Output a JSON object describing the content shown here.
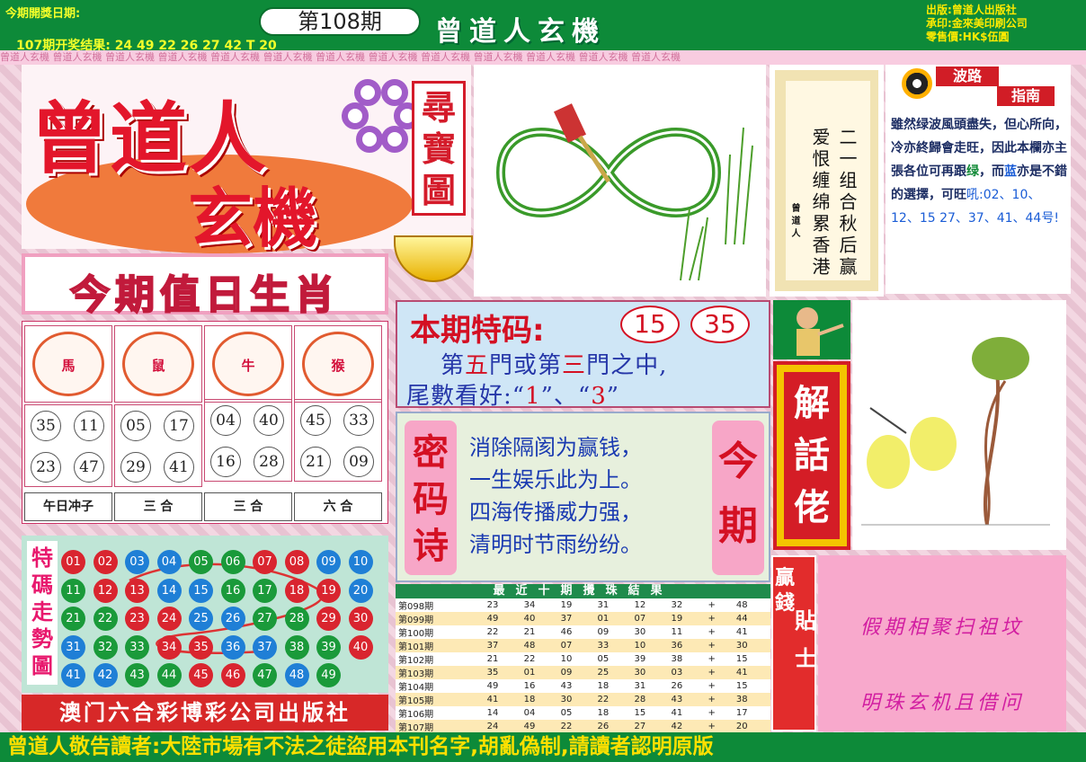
{
  "header": {
    "date_label": "今期開獎日期:",
    "prev_result": "107期开奖结果:  24 49 22 26 27 42 T 20",
    "issue": "第108期",
    "brand": "曾道人玄機",
    "publisher": [
      "出版:曾道人出版社",
      "承印:金來美印刷公司",
      "零售價:HK$伍圓"
    ]
  },
  "strip": "曾道人玄機 曾道人玄機 曾道人玄機 曾道人玄機 曾道人玄機 曾道人玄機 曾道人玄機 曾道人玄機 曾道人玄機 曾道人玄機 曾道人玄機 曾道人玄機 曾道人玄機",
  "logo": {
    "line1": "曾道人",
    "line2": "玄機",
    "side": "尋寶圖"
  },
  "zodiac": {
    "title": "今期值日生肖",
    "animals": [
      {
        "char": "馬"
      },
      {
        "char": "鼠"
      },
      {
        "char": "牛"
      },
      {
        "char": "猴"
      }
    ],
    "numbers": [
      [
        "35",
        "11",
        "23",
        "47"
      ],
      [
        "05",
        "17",
        "29",
        "41"
      ],
      [
        "04",
        "40",
        "16",
        "28"
      ],
      [
        "45",
        "33",
        "21",
        "09"
      ]
    ],
    "labels": [
      "午日冲子",
      "三  合",
      "三  合",
      "六  合"
    ]
  },
  "trend": {
    "label": "特碼走勢圖",
    "rows": [
      [
        [
          "01",
          "r"
        ],
        [
          "02",
          "r"
        ],
        [
          "03",
          "b"
        ],
        [
          "04",
          "b"
        ],
        [
          "05",
          "g"
        ],
        [
          "06",
          "g"
        ],
        [
          "07",
          "r"
        ],
        [
          "08",
          "r"
        ],
        [
          "09",
          "b"
        ],
        [
          "10",
          "b"
        ]
      ],
      [
        [
          "11",
          "g"
        ],
        [
          "12",
          "r"
        ],
        [
          "13",
          "r"
        ],
        [
          "14",
          "b"
        ],
        [
          "15",
          "b"
        ],
        [
          "16",
          "g"
        ],
        [
          "17",
          "g"
        ],
        [
          "18",
          "r"
        ],
        [
          "19",
          "r"
        ],
        [
          "20",
          "b"
        ]
      ],
      [
        [
          "21",
          "g"
        ],
        [
          "22",
          "g"
        ],
        [
          "23",
          "r"
        ],
        [
          "24",
          "r"
        ],
        [
          "25",
          "b"
        ],
        [
          "26",
          "b"
        ],
        [
          "27",
          "g"
        ],
        [
          "28",
          "g"
        ],
        [
          "29",
          "r"
        ],
        [
          "30",
          "r"
        ]
      ],
      [
        [
          "31",
          "b"
        ],
        [
          "32",
          "g"
        ],
        [
          "33",
          "g"
        ],
        [
          "34",
          "r"
        ],
        [
          "35",
          "r"
        ],
        [
          "36",
          "b"
        ],
        [
          "37",
          "b"
        ],
        [
          "38",
          "g"
        ],
        [
          "39",
          "g"
        ],
        [
          "40",
          "r"
        ]
      ],
      [
        [
          "41",
          "b"
        ],
        [
          "42",
          "b"
        ],
        [
          "43",
          "g"
        ],
        [
          "44",
          "g"
        ],
        [
          "45",
          "r"
        ],
        [
          "46",
          "r"
        ],
        [
          "47",
          "g"
        ],
        [
          "48",
          "b"
        ],
        [
          "49",
          "g"
        ]
      ]
    ]
  },
  "macau": "澳门六合彩博彩公司出版社",
  "scroll": {
    "col1": "二一组合秋后赢",
    "col2": "爱恨缠绵累香港",
    "sign": "曾道人"
  },
  "wave": {
    "title1": "波路",
    "title2": "指南",
    "text1": "雖然绿波風頭盡失，但心所向，冷亦終歸會走旺，因此本欄亦主張各位可再跟",
    "g": "绿",
    "mid": "，而",
    "bl": "蓝",
    "text2": "亦是不錯的選擇，可旺",
    "nums": "吼:02、10、12、15  27、37、41、44号!"
  },
  "tecode": {
    "title": "本期特码:",
    "n1": "15",
    "n2": "35",
    "line2a": "第",
    "line2b": "五",
    "line2c": "門或第",
    "line2d": "三",
    "line2e": "門之中,",
    "line3a": "尾數看好:“",
    "line3b": "1",
    "line3c": "”、“",
    "line3d": "3",
    "line3e": "”"
  },
  "poem": {
    "left": "密码诗",
    "right": "今期",
    "lines": [
      "消除隔阂为赢钱，",
      "一生娱乐此为上。",
      "四海传播威力强，",
      "清明时节雨纷纷。"
    ]
  },
  "last10": {
    "title": "最近十期攪珠結果",
    "rows": [
      [
        "第098期",
        "23",
        "34",
        "19",
        "31",
        "12",
        "32",
        "+",
        "48"
      ],
      [
        "第099期",
        "49",
        "40",
        "37",
        "01",
        "07",
        "19",
        "+",
        "44"
      ],
      [
        "第100期",
        "22",
        "21",
        "46",
        "09",
        "30",
        "11",
        "+",
        "41"
      ],
      [
        "第101期",
        "37",
        "48",
        "07",
        "33",
        "10",
        "36",
        "+",
        "30"
      ],
      [
        "第102期",
        "21",
        "22",
        "10",
        "05",
        "39",
        "38",
        "+",
        "15"
      ],
      [
        "第103期",
        "35",
        "01",
        "09",
        "25",
        "30",
        "03",
        "+",
        "41"
      ],
      [
        "第104期",
        "49",
        "16",
        "43",
        "18",
        "31",
        "26",
        "+",
        "15"
      ],
      [
        "第105期",
        "41",
        "18",
        "30",
        "22",
        "28",
        "43",
        "+",
        "38"
      ],
      [
        "第106期",
        "14",
        "04",
        "05",
        "18",
        "15",
        "41",
        "+",
        "17"
      ],
      [
        "第107期",
        "24",
        "49",
        "22",
        "26",
        "27",
        "42",
        "+",
        "20"
      ]
    ]
  },
  "jhl": "解話佬",
  "yq": {
    "a": "贏錢",
    "b": "貼士"
  },
  "tips": {
    "l1": "假期相聚扫祖坟",
    "l2": "明珠玄机且借问"
  },
  "bottom": "曾道人敬告讀者:大陸市場有不法之徒盜用本刊名字,胡亂偽制,請讀者認明原版"
}
